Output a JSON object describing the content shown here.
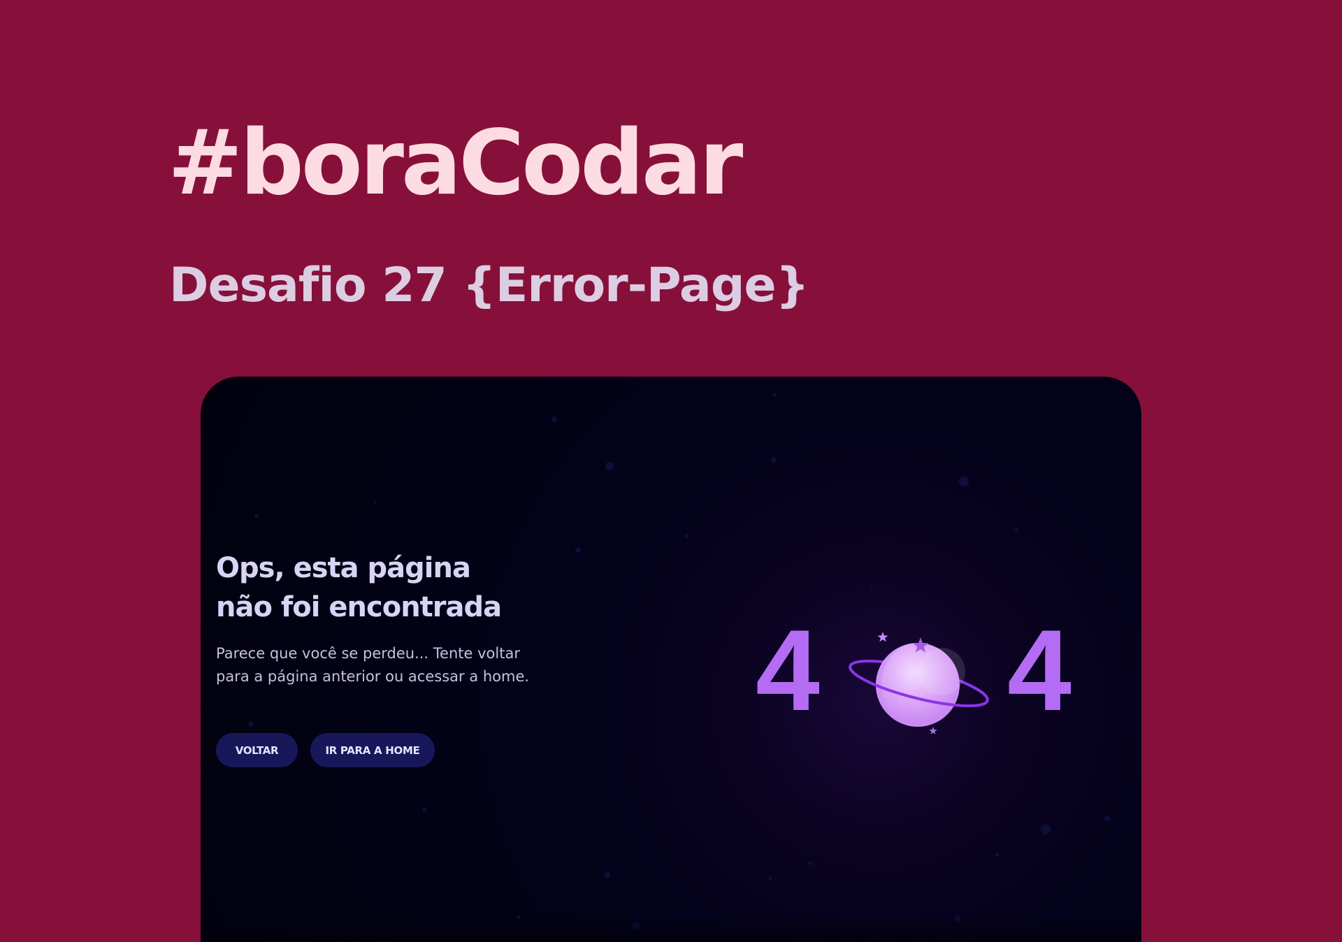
{
  "header": {
    "title": "#boraCodar",
    "subtitle": "Desafio 27 {Error-Page}"
  },
  "error_card": {
    "headline_line1": "Ops, esta página",
    "headline_line2": "não foi encontrada",
    "description_line1": "Parece que você se perdeu... Tente voltar",
    "description_line2": "para a página anterior ou acessar a home.",
    "buttons": {
      "back_label": "VOLTAR",
      "home_label": "IR PARA A HOME"
    },
    "code_digit_left": "4",
    "code_digit_right": "4"
  },
  "colors": {
    "page_background": "#86103a",
    "title": "#fcdbe2",
    "subtitle": "#dccde3",
    "card_background": "#020214",
    "digit": "#b56cf4",
    "button_background": "#17175a"
  },
  "icons": {
    "planet": "planet-icon",
    "stars": "star-icon"
  }
}
